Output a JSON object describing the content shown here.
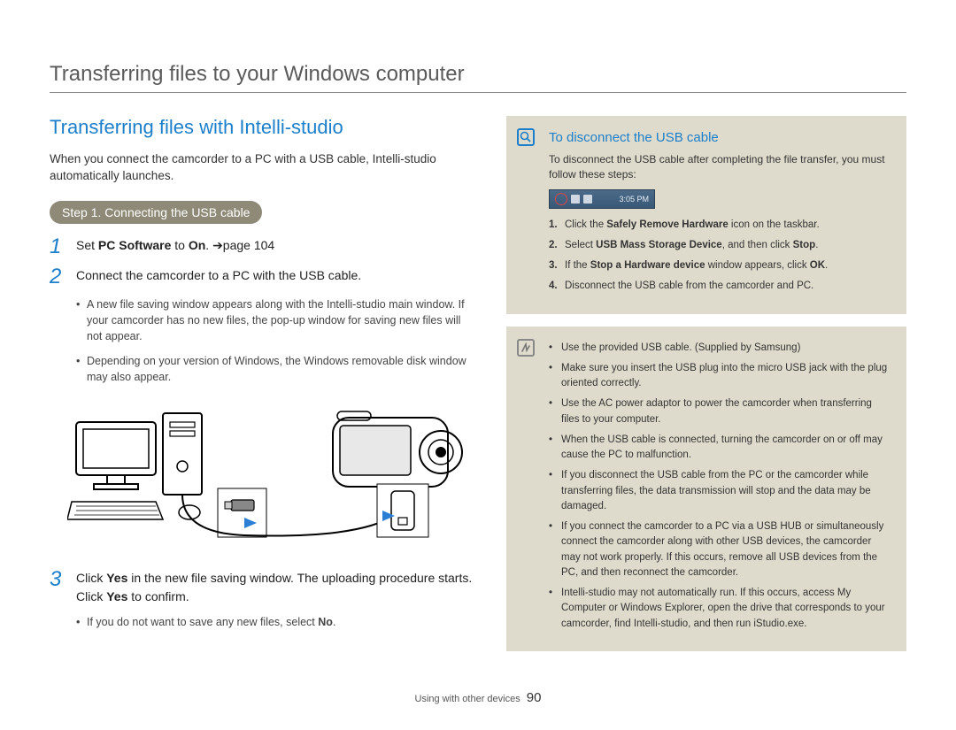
{
  "page_title": "Transferring files to your Windows computer",
  "left": {
    "section_title": "Transferring files with Intelli-studio",
    "intro": "When you connect the camcorder to a PC with a USB cable, Intelli-studio automatically launches.",
    "step_pill": "Step 1. Connecting the USB cable",
    "items": {
      "n1": "1",
      "t1_pre": "Set ",
      "t1_b1": "PC Software",
      "t1_mid": " to ",
      "t1_b2": "On",
      "t1_post": ". ",
      "t1_ref": "➔page 104",
      "n2": "2",
      "t2": "Connect the camcorder to a PC with the USB cable.",
      "t2_bullets": [
        "A new file saving window appears along with the Intelli-studio main window. If your camcorder has no new files, the pop-up window for saving new files will not appear.",
        "Depending on your version of Windows, the Windows removable disk window may also appear."
      ],
      "n3": "3",
      "t3_pre": "Click ",
      "t3_b1": "Yes",
      "t3_mid": " in the new file saving window. The uploading procedure starts. Click ",
      "t3_b2": "Yes",
      "t3_post": " to confirm.",
      "t3_bullets_pre": "If you do not want to save any new files, select ",
      "t3_bullets_b": "No",
      "t3_bullets_post": "."
    }
  },
  "right": {
    "disconnect": {
      "title": "To disconnect the USB cable",
      "text": "To disconnect the USB cable after completing the file transfer, you must follow these steps:",
      "tray_time": "3:05 PM",
      "steps": {
        "s1_pre": "Click the ",
        "s1_b": "Safely Remove Hardware",
        "s1_post": " icon on the taskbar.",
        "s2_pre": "Select ",
        "s2_b1": "USB Mass Storage Device",
        "s2_mid": ", and then click ",
        "s2_b2": "Stop",
        "s2_post": ".",
        "s3_pre": "If the ",
        "s3_b1": "Stop a Hardware device",
        "s3_mid": " window appears, click ",
        "s3_b2": "OK",
        "s3_post": ".",
        "s4": "Disconnect the USB cable from the camcorder and PC."
      }
    },
    "notes": [
      "Use the provided USB cable. (Supplied by Samsung)",
      "Make sure you insert the USB plug into the micro USB jack with the plug oriented correctly.",
      "Use the AC power adaptor to power the camcorder when transferring files to your computer.",
      "When the USB cable is connected, turning the camcorder on or off may cause the PC to malfunction.",
      "If you disconnect the USB cable from the PC or the camcorder while transferring files, the data transmission will stop and the data may be damaged.",
      "If you connect the camcorder to a PC via a USB HUB or simultaneously connect the camcorder along with other USB devices, the camcorder may not work properly. If this occurs, remove all USB devices from the PC, and then reconnect the camcorder.",
      "Intelli-studio may not automatically run. If this occurs, access My Computer or Windows Explorer, open the drive that corresponds to your camcorder, find Intelli-studio, and then run iStudio.exe."
    ]
  },
  "footer": {
    "section": "Using with other devices",
    "page": "90"
  }
}
